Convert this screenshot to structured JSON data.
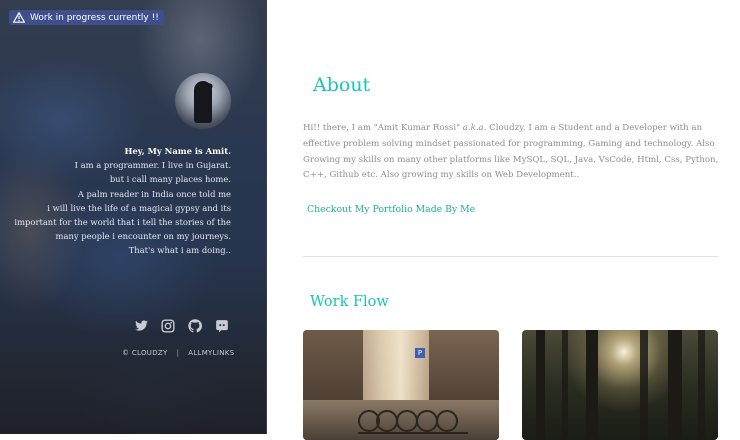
{
  "sidebar": {
    "badge": {
      "icon": "warning-icon",
      "text": "Work in progress currently !!"
    },
    "avatar": {
      "alt": "profile"
    },
    "intro_lines": [
      "Hey, My Name is Amit.",
      "I am a programmer. I live in Gujarat.",
      "but i call many places home.",
      "A palm reader in India once told me",
      "i will live the life of a magical gypsy and its",
      "important for the world that i tell the stories of the",
      "many people i encounter on my journeys.",
      "That's what i am doing.."
    ],
    "social_icons": [
      "twitter-icon",
      "instagram-icon",
      "github-icon",
      "discord-icon"
    ],
    "footer": {
      "copyright": "© CLOUDZY",
      "separator": "|",
      "link": "ALLMYLINKS"
    }
  },
  "main": {
    "about": {
      "title": "About",
      "body_before": "Hi!! there, I am \"Amit Kumar Rossi\" ",
      "body_aka": "a.k.a.",
      "body_after": " Cloudzy. I am a Student and a Developer with an effective problem solving mindset passionated for programming, Gaming and technology. Also Growing my skills on many other platforms like MySQL, SQL, Java, VsCode, Html, Css, Python, C++, Github etc. Also growing my skills on Web Development..",
      "link": "Checkout My Portfolio Made By Me"
    },
    "workflow": {
      "title": "Work Flow",
      "images": [
        "street-bicycles-photo",
        "forest-sunlight-photo"
      ],
      "street_sign": "P"
    }
  },
  "colors": {
    "accent": "#19c5b7",
    "link": "#1eae97",
    "badge": "#3f4f8c"
  }
}
